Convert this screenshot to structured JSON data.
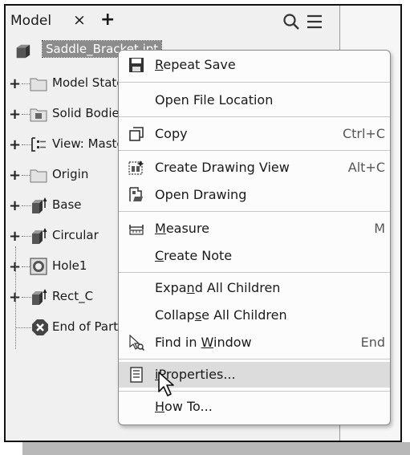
{
  "tab": {
    "label": "Model",
    "close": "×",
    "add": "+"
  },
  "tree": {
    "root": "Saddle_Bracket.ipt",
    "items": [
      {
        "label": "Model States",
        "icon": "folder-icon"
      },
      {
        "label": "Solid Bodies",
        "icon": "solid-bodies-icon"
      },
      {
        "label": "View: Master",
        "icon": "view-icon"
      },
      {
        "label": "Origin",
        "icon": "folder-icon"
      },
      {
        "label": "Base",
        "icon": "extrude-icon"
      },
      {
        "label": "Circular",
        "icon": "extrude-icon"
      },
      {
        "label": "Hole1",
        "icon": "hole-icon"
      },
      {
        "label": "Rect_C",
        "icon": "extrude-icon"
      },
      {
        "label": "End of Part",
        "icon": "end-of-part-icon"
      }
    ]
  },
  "context_menu": {
    "repeat_save": {
      "pre": "",
      "u": "R",
      "post": "epeat Save"
    },
    "open_file_location": {
      "text": "Open File Location"
    },
    "copy": {
      "text": "Copy",
      "shortcut": "Ctrl+C"
    },
    "create_drawing_view": {
      "text": "Create Drawing View",
      "shortcut": "Alt+C"
    },
    "open_drawing": {
      "text": "Open Drawing"
    },
    "measure": {
      "pre": "",
      "u": "M",
      "post": "easure",
      "shortcut": "M"
    },
    "create_note": {
      "pre": "",
      "u": "C",
      "post": "reate Note"
    },
    "expand_all": {
      "pre": "Expa",
      "u": "n",
      "post": "d All Children"
    },
    "collapse_all": {
      "pre": "Collap",
      "u": "s",
      "post": "e All Children"
    },
    "find_in_window": {
      "pre": "Find in ",
      "u": "W",
      "post": "indow",
      "shortcut": "End"
    },
    "iproperties": {
      "pre": "",
      "u": "i",
      "post": "Properties..."
    },
    "how_to": {
      "pre": "",
      "u": "H",
      "post": "ow To..."
    }
  }
}
